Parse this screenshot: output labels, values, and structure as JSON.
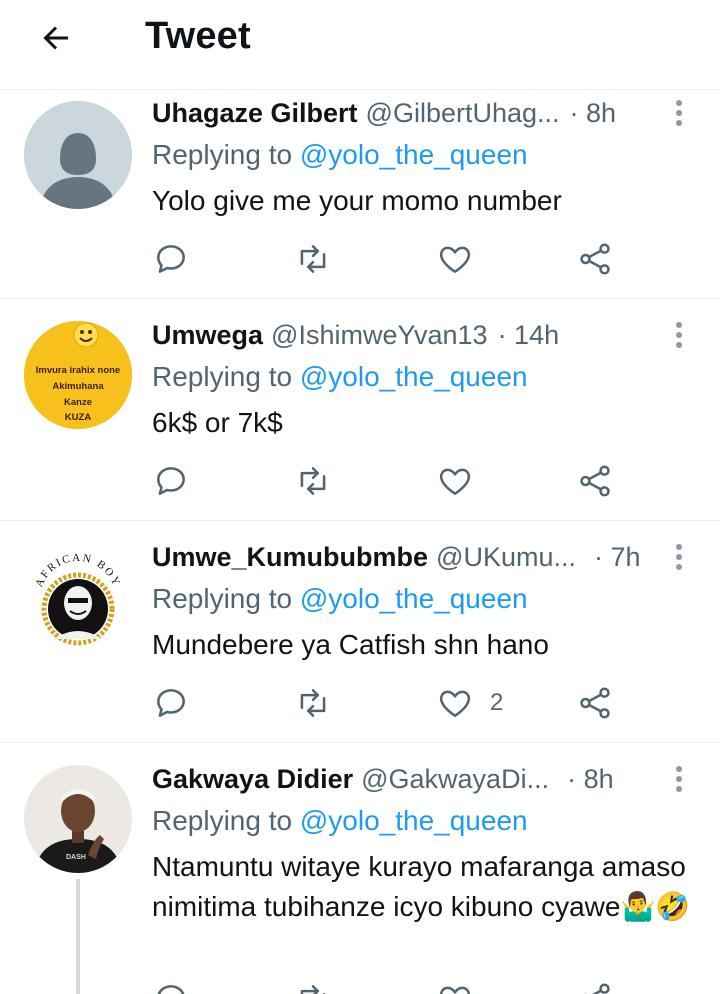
{
  "header": {
    "title": "Tweet",
    "back_icon": "back-arrow-icon"
  },
  "tweets": [
    {
      "name": "Uhagaze Gilbert",
      "handle": "@GilbertUhag...",
      "time": "· 8h",
      "replying_prefix": "Replying to",
      "replying_to": "@yolo_the_queen",
      "text": "Yolo give me your momo number",
      "likes": ""
    },
    {
      "name": "Umwega",
      "handle": "@IshimweYvan13",
      "time": "· 14h",
      "replying_prefix": "Replying to",
      "replying_to": "@yolo_the_queen",
      "text": "6k$ or 7k$",
      "likes": "",
      "avatar_text": [
        "Imvura irahix none",
        "Akimuhana",
        "Kanze",
        "KUZA"
      ]
    },
    {
      "name": "Umwe_Kumububmbe",
      "handle": "@UKumu...",
      "time": "· 7h",
      "replying_prefix": "Replying to",
      "replying_to": "@yolo_the_queen",
      "text": "Mundebere ya Catfish shn hano",
      "likes": "2",
      "avatar_text": "AFRICAN BOY"
    },
    {
      "name": "Gakwaya Didier",
      "handle": "@GakwayaDi...",
      "time": "· 8h",
      "replying_prefix": "Replying to",
      "replying_to": "@yolo_the_queen",
      "text": "Ntamuntu witaye kurayo mafaranga amaso nimitima tubihanze icyo kibuno cyawe🤷‍♂️🤣",
      "likes": ""
    }
  ],
  "colors": {
    "accent": "#1d9bf0",
    "secondary_text": "#536471",
    "divider": "#e6ecf0"
  }
}
